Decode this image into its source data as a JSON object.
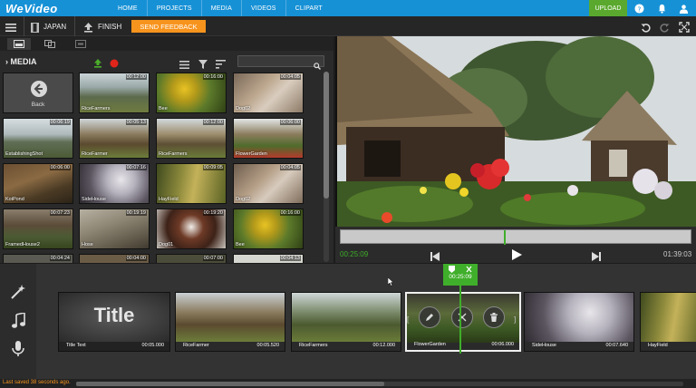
{
  "app": {
    "logo": "WeVideo",
    "nav": [
      "HOME",
      "PROJECTS",
      "MEDIA",
      "VIDEOS",
      "CLIPART"
    ],
    "upload_label": "UPLOAD",
    "brand_color": "#1791d6",
    "upload_color": "#5aa92e"
  },
  "project": {
    "title": "JAPAN",
    "finish_label": "FINISH",
    "feedback_label": "SEND FEEDBACK",
    "feedback_color": "#f7941d"
  },
  "media": {
    "title": "MEDIA",
    "search_placeholder": "",
    "back_label": "Back",
    "items": [
      {
        "name": "RiceFarmers",
        "duration": "00:12:00"
      },
      {
        "name": "Bee",
        "duration": "00:16:00"
      },
      {
        "name": "Dog02",
        "duration": "00:04:05"
      },
      {
        "name": "EstablishingShot",
        "duration": "00:06:19"
      },
      {
        "name": "RiceFarmer",
        "duration": "00:05:13"
      },
      {
        "name": "RiceFarmers",
        "duration": "00:12:00"
      },
      {
        "name": "FlowerGarden",
        "duration": "00:06:00"
      },
      {
        "name": "KoiPond",
        "duration": "00:06:00"
      },
      {
        "name": "SideHouse",
        "duration": "00:07:16"
      },
      {
        "name": "HayField",
        "duration": "00:09:05"
      },
      {
        "name": "Dog02",
        "duration": "00:04:05"
      },
      {
        "name": "FramedHouse2",
        "duration": "00:07:23"
      },
      {
        "name": "Hose",
        "duration": "00:19:19"
      },
      {
        "name": "Dog01",
        "duration": "00:19:20"
      },
      {
        "name": "Bee",
        "duration": "00:16:00"
      },
      {
        "name": "",
        "duration": "00:04:24"
      },
      {
        "name": "",
        "duration": "00:04:00"
      },
      {
        "name": "",
        "duration": "00:07:00"
      },
      {
        "name": "",
        "duration": "00:04:13"
      }
    ]
  },
  "preview": {
    "current_time": "00:25:09",
    "total_time": "01:39:03"
  },
  "timeline": {
    "playhead_time": "00:25:09",
    "clips": [
      {
        "name": "Title Text",
        "duration": "00:05.000",
        "title": "Title"
      },
      {
        "name": "RiceFarmer",
        "duration": "00:05.520"
      },
      {
        "name": "RiceFarmers",
        "duration": "00:12.000"
      },
      {
        "name": "FlowerGarden",
        "duration": "00:06.000"
      },
      {
        "name": "SideHouse",
        "duration": "00:07.640"
      },
      {
        "name": "HayField",
        "duration": ""
      }
    ]
  },
  "status": {
    "saved_text": "Last saved 38 seconds ago."
  }
}
